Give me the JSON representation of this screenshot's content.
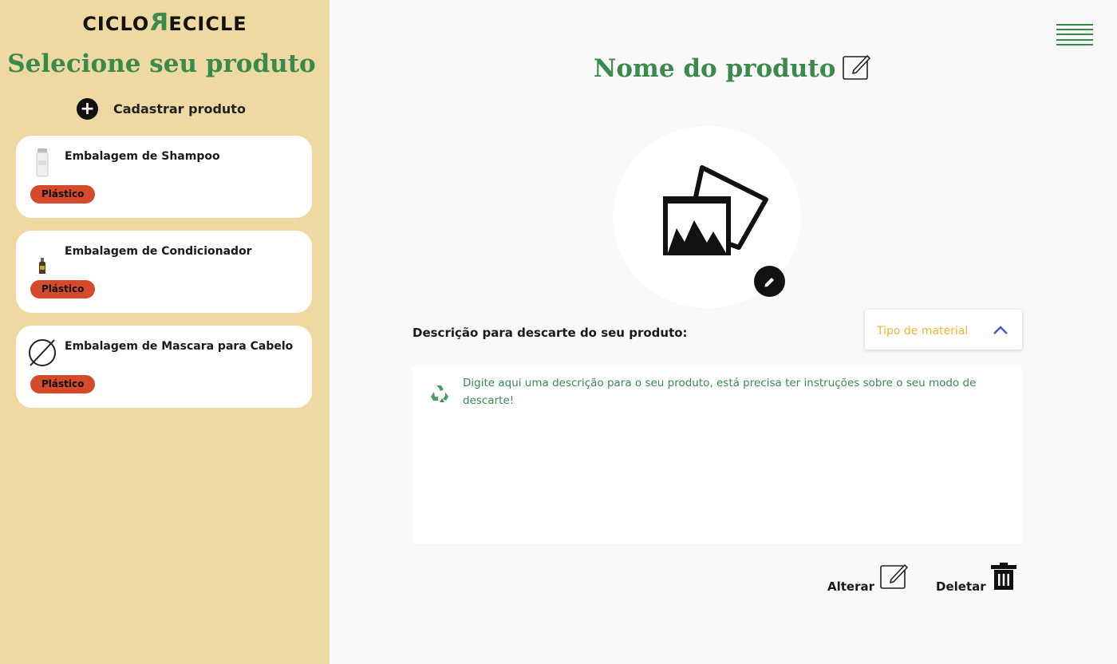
{
  "sidebar": {
    "logo": {
      "part1": "CICLO",
      "part2": "R",
      "part3": "ECICLE"
    },
    "title": "Selecione seu produto",
    "add_label": "Cadastrar produto",
    "products": [
      {
        "name": "Embalagem de Shampoo",
        "material": "Plástico",
        "thumb_icon": "shampoo-bottle-icon"
      },
      {
        "name": "Embalagem de Condicionador",
        "material": "Plástico",
        "thumb_icon": "conditioner-bottle-icon"
      },
      {
        "name": "Embalagem de Mascara para Cabelo",
        "material": "Plástico",
        "thumb_icon": "no-image-icon"
      }
    ]
  },
  "main": {
    "product_title": "Nome do produto",
    "description_label": "Descrição para descarte do seu produto:",
    "material_select": {
      "placeholder": "Tipo de material",
      "chevron_icon": "chevron-up-icon"
    },
    "description_placeholder": "Digite aqui uma descrição para o seu produto,  está precisa ter instruções sobre o seu modo de descarte!",
    "actions": {
      "alter_label": "Alterar",
      "delete_label": "Deletar"
    }
  },
  "colors": {
    "sidebar_bg": "#eed9a2",
    "brand_green": "#3a8a4e",
    "badge_red": "#d44a2a",
    "placeholder_yellow": "#f2b53a",
    "chevron_blue": "#3d5fc4"
  }
}
